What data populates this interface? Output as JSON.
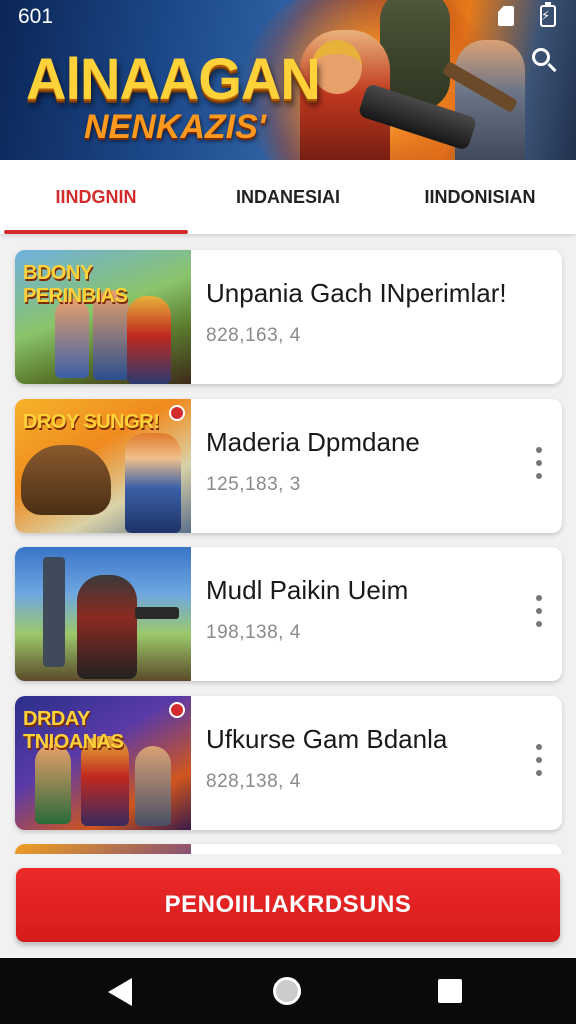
{
  "status_bar": {
    "time": "601",
    "icons": [
      "sim-icon",
      "battery-charging-icon"
    ]
  },
  "banner": {
    "logo_main": "AlNAAGAN",
    "logo_sub": "NENKAZIS'",
    "search_icon": "search-icon"
  },
  "tabs": [
    {
      "label": "IINDGNIN",
      "active": true
    },
    {
      "label": "INDANESIAI",
      "active": false
    },
    {
      "label": "IINDONISIAN",
      "active": false
    }
  ],
  "games": [
    {
      "title": "Unpania  Gach  INperimlar!",
      "meta": "828,163, 4",
      "thumb_text": "BDONY PERINBIAS",
      "has_menu": false
    },
    {
      "title": "Maderia Dpmdane",
      "meta": "125,183, 3",
      "thumb_text": "DROY SUNGR!",
      "has_menu": true
    },
    {
      "title": "Mudl Paikin Ueim",
      "meta": "198,138, 4",
      "thumb_text": "",
      "has_menu": true
    },
    {
      "title": "Ufkurse Gam Bdanla",
      "meta": "828,138, 4",
      "thumb_text": "DRDAY TNIOANAS",
      "has_menu": true
    }
  ],
  "action_button": {
    "label": "PENOIILIAKRDSUNS"
  },
  "nav_bar": {
    "icons": [
      "back-icon",
      "home-icon",
      "recents-icon"
    ]
  },
  "colors": {
    "accent": "#d42c2c",
    "nav_bg": "#0a0a0a",
    "list_bg": "#f1f1f1"
  }
}
